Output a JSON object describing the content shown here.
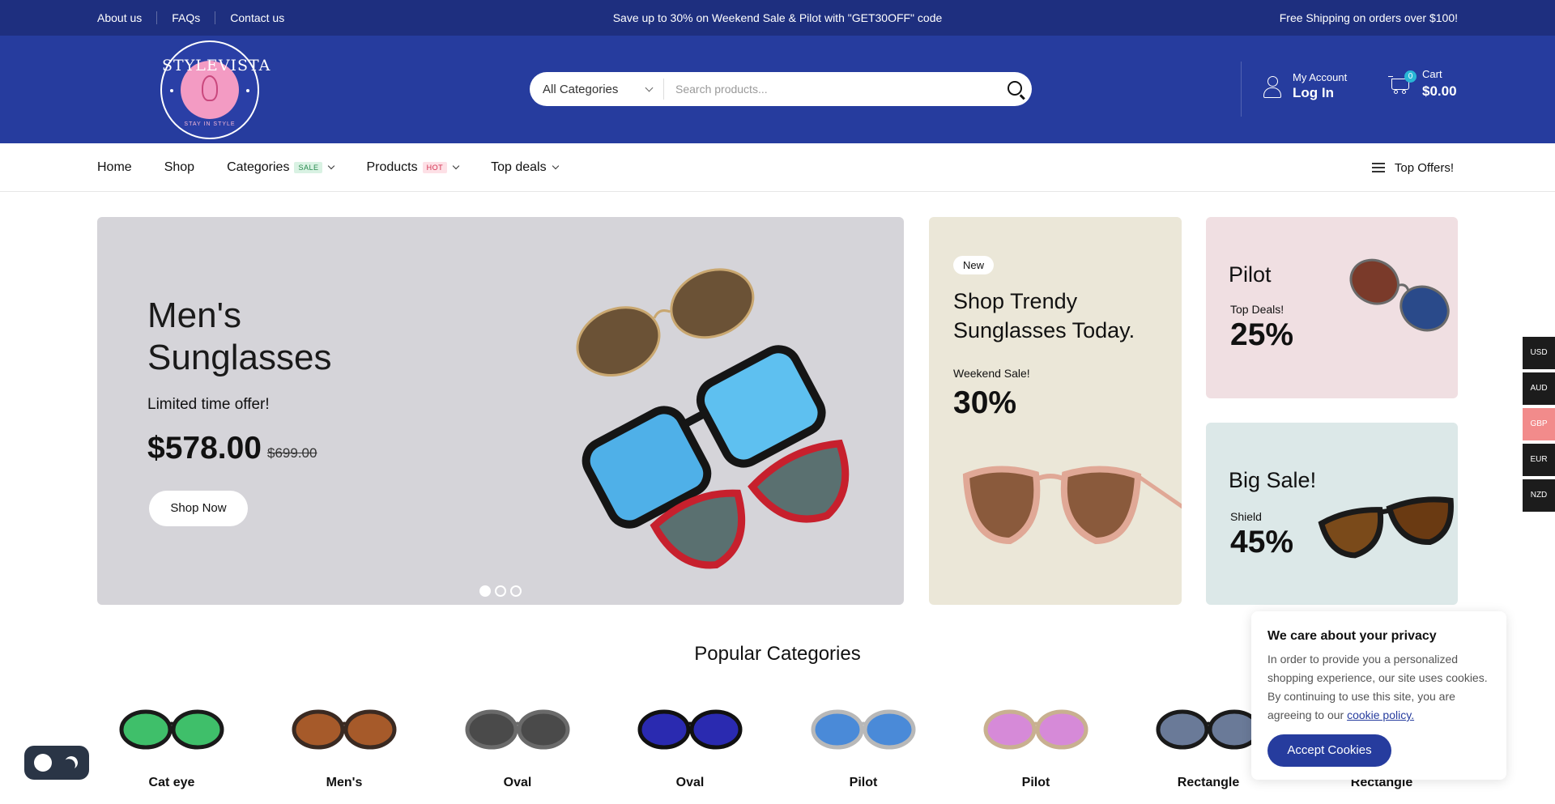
{
  "topbar": {
    "links": [
      "About us",
      "FAQs",
      "Contact us"
    ],
    "promo": "Save up to 30% on Weekend Sale & Pilot with \"GET30OFF\" code",
    "shipping": "Free Shipping on orders over $100!"
  },
  "logo": {
    "brand": "STYLEVISTA",
    "tagline": "STAY IN STYLE"
  },
  "search": {
    "category": "All Categories",
    "placeholder": "Search products..."
  },
  "account": {
    "label": "My Account",
    "action": "Log In"
  },
  "cart": {
    "label": "Cart",
    "total": "$0.00",
    "count": "0"
  },
  "nav": {
    "items": [
      {
        "label": "Home"
      },
      {
        "label": "Shop"
      },
      {
        "label": "Categories",
        "tag": "SALE"
      },
      {
        "label": "Products",
        "tag": "HOT"
      },
      {
        "label": "Top deals"
      }
    ],
    "offers": "Top Offers!"
  },
  "hero": {
    "title": "Men's Sunglasses",
    "subtitle": "Limited time offer!",
    "price": "$578.00",
    "old_price": "$699.00",
    "button": "Shop Now",
    "slides": 3,
    "active_slide": 1
  },
  "promo1": {
    "badge": "New",
    "title": "Shop Trendy Sunglasses Today.",
    "label": "Weekend Sale!",
    "percent": "30%"
  },
  "promo2": {
    "title": "Pilot",
    "label": "Top Deals!",
    "percent": "25%"
  },
  "promo3": {
    "title": "Big Sale!",
    "label": "Shield",
    "percent": "45%"
  },
  "currency": {
    "options": [
      "USD",
      "AUD",
      "GBP",
      "EUR",
      "NZD"
    ],
    "active": "GBP"
  },
  "categories": {
    "title": "Popular Categories",
    "items": [
      {
        "label": "Cat eye",
        "lens": "#3fbf6a",
        "frame": "#1a1a1a"
      },
      {
        "label": "Men's",
        "lens": "#a65a2a",
        "frame": "#3a2a22"
      },
      {
        "label": "Oval",
        "lens": "#4a4a4a",
        "frame": "#6a6a6a"
      },
      {
        "label": "Oval",
        "lens": "#2a2ab0",
        "frame": "#111111"
      },
      {
        "label": "Pilot",
        "lens": "#4a8ad8",
        "frame": "#b8b8b8"
      },
      {
        "label": "Pilot",
        "lens": "#d68ad8",
        "frame": "#c8b090"
      },
      {
        "label": "Rectangle",
        "lens": "#6a7a98",
        "frame": "#1a1a1a"
      },
      {
        "label": "Rectangle",
        "lens": "#555555",
        "frame": "#222222"
      }
    ]
  },
  "cookie": {
    "title": "We care about your privacy",
    "body": "In order to provide you a personalized shopping experience, our site uses cookies. By continuing to use this site, you are agreeing to our",
    "link": "cookie policy.",
    "button": "Accept Cookies"
  },
  "colors": {
    "topbar": "#1e2f7f",
    "header": "#263c9e",
    "accent": "#263c9e"
  }
}
